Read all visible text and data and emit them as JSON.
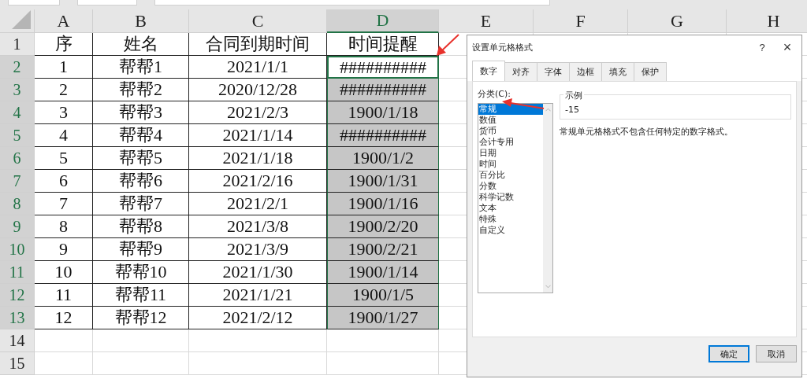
{
  "sheet": {
    "columns": [
      {
        "label": "A",
        "selected": false
      },
      {
        "label": "B",
        "selected": false
      },
      {
        "label": "C",
        "selected": false
      },
      {
        "label": "D",
        "selected": true
      },
      {
        "label": "E",
        "selected": false
      },
      {
        "label": "F",
        "selected": false
      },
      {
        "label": "G",
        "selected": false
      },
      {
        "label": "H",
        "selected": false
      }
    ],
    "rows": [
      {
        "number": "1",
        "selected": false,
        "active": false,
        "cells": [
          "序",
          "姓名",
          "合同到期时间",
          "时间提醒"
        ]
      },
      {
        "number": "2",
        "selected": true,
        "active": true,
        "cells": [
          "1",
          "帮帮1",
          "2021/1/1",
          "##########"
        ]
      },
      {
        "number": "3",
        "selected": true,
        "active": false,
        "cells": [
          "2",
          "帮帮2",
          "2020/12/28",
          "##########"
        ]
      },
      {
        "number": "4",
        "selected": true,
        "active": false,
        "cells": [
          "3",
          "帮帮3",
          "2021/2/3",
          "1900/1/18"
        ]
      },
      {
        "number": "5",
        "selected": true,
        "active": false,
        "cells": [
          "4",
          "帮帮4",
          "2021/1/14",
          "##########"
        ]
      },
      {
        "number": "6",
        "selected": true,
        "active": false,
        "cells": [
          "5",
          "帮帮5",
          "2021/1/18",
          "1900/1/2"
        ]
      },
      {
        "number": "7",
        "selected": true,
        "active": false,
        "cells": [
          "6",
          "帮帮6",
          "2021/2/16",
          "1900/1/31"
        ]
      },
      {
        "number": "8",
        "selected": true,
        "active": false,
        "cells": [
          "7",
          "帮帮7",
          "2021/2/1",
          "1900/1/16"
        ]
      },
      {
        "number": "9",
        "selected": true,
        "active": false,
        "cells": [
          "8",
          "帮帮8",
          "2021/3/8",
          "1900/2/20"
        ]
      },
      {
        "number": "10",
        "selected": true,
        "active": false,
        "cells": [
          "9",
          "帮帮9",
          "2021/3/9",
          "1900/2/21"
        ]
      },
      {
        "number": "11",
        "selected": true,
        "active": false,
        "cells": [
          "10",
          "帮帮10",
          "2021/1/30",
          "1900/1/14"
        ]
      },
      {
        "number": "12",
        "selected": true,
        "active": false,
        "cells": [
          "11",
          "帮帮11",
          "2021/1/21",
          "1900/1/5"
        ]
      },
      {
        "number": "13",
        "selected": true,
        "active": false,
        "cells": [
          "12",
          "帮帮12",
          "2021/2/12",
          "1900/1/27"
        ]
      },
      {
        "number": "14",
        "selected": false,
        "active": false,
        "cells": []
      },
      {
        "number": "15",
        "selected": false,
        "active": false,
        "cells": []
      }
    ]
  },
  "dialog": {
    "title": "设置单元格格式",
    "help": "?",
    "close": "×",
    "tabs": [
      {
        "label": "数字",
        "selected": true
      },
      {
        "label": "对齐",
        "selected": false
      },
      {
        "label": "字体",
        "selected": false
      },
      {
        "label": "边框",
        "selected": false
      },
      {
        "label": "填充",
        "selected": false
      },
      {
        "label": "保护",
        "selected": false
      }
    ],
    "category_label": "分类(C):",
    "categories": [
      {
        "label": "常规",
        "selected": true
      },
      {
        "label": "数值",
        "selected": false
      },
      {
        "label": "货币",
        "selected": false
      },
      {
        "label": "会计专用",
        "selected": false
      },
      {
        "label": "日期",
        "selected": false
      },
      {
        "label": "时间",
        "selected": false
      },
      {
        "label": "百分比",
        "selected": false
      },
      {
        "label": "分数",
        "selected": false
      },
      {
        "label": "科学记数",
        "selected": false
      },
      {
        "label": "文本",
        "selected": false
      },
      {
        "label": "特殊",
        "selected": false
      },
      {
        "label": "自定义",
        "selected": false
      }
    ],
    "sample_label": "示例",
    "sample_value": "-15",
    "description": "常规单元格格式不包含任何特定的数字格式。",
    "buttons": [
      {
        "label": "确定",
        "default": true
      },
      {
        "label": "取消",
        "default": false
      }
    ]
  }
}
